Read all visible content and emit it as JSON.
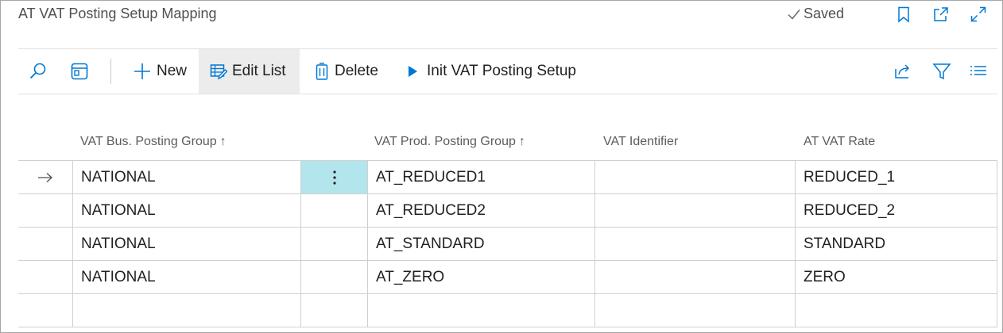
{
  "header": {
    "title": "AT VAT Posting Setup Mapping",
    "saved_label": "Saved"
  },
  "toolbar": {
    "new_label": "New",
    "edit_list_label": "Edit List",
    "delete_label": "Delete",
    "init_label": "Init VAT Posting Setup"
  },
  "table": {
    "columns": {
      "bus_group": "VAT Bus. Posting Group",
      "prod_group": "VAT Prod. Posting Group",
      "identifier": "VAT Identifier",
      "rate": "AT VAT Rate"
    },
    "sort_indicator": "↑",
    "rows": [
      {
        "bus": "NATIONAL",
        "prod": "AT_REDUCED1",
        "identifier": "",
        "rate": "REDUCED_1"
      },
      {
        "bus": "NATIONAL",
        "prod": "AT_REDUCED2",
        "identifier": "",
        "rate": "REDUCED_2"
      },
      {
        "bus": "NATIONAL",
        "prod": "AT_STANDARD",
        "identifier": "",
        "rate": "STANDARD"
      },
      {
        "bus": "NATIONAL",
        "prod": "AT_ZERO",
        "identifier": "",
        "rate": "ZERO"
      },
      {
        "bus": "",
        "prod": "",
        "identifier": "",
        "rate": ""
      }
    ],
    "selected_row": 0
  },
  "colors": {
    "accent": "#0078d4",
    "selected_cell": "#b3e5ec",
    "active_button_bg": "#ececec"
  },
  "icons": {
    "saved": "checkmark-icon",
    "bookmark": "bookmark-icon",
    "open_new": "open-in-new-window-icon",
    "expand": "expand-icon",
    "search": "search-icon",
    "view": "view-toggle-icon",
    "new": "plus-icon",
    "edit": "edit-list-icon",
    "delete": "trash-icon",
    "init": "play-icon",
    "share": "share-icon",
    "filter": "filter-icon",
    "list": "list-view-icon",
    "row_arrow": "arrow-right-icon",
    "row_menu": "more-vertical-icon"
  }
}
